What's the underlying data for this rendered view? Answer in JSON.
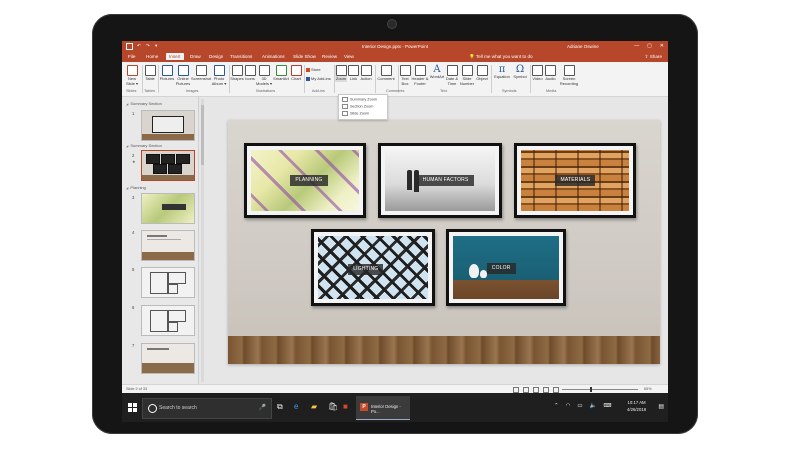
{
  "titlebar": {
    "doc_title": "Interior Design.pptx - PowerPoint",
    "user": "Adriane Oswine",
    "min": "—",
    "restore": "▢",
    "close": "✕"
  },
  "tabs": {
    "file": "File",
    "home": "Home",
    "insert": "Insert",
    "draw": "Draw",
    "design": "Design",
    "transitions": "Transitions",
    "animations": "Animations",
    "slideshow": "Slide Show",
    "review": "Review",
    "view": "View",
    "tellme": "Tell me what you want to do",
    "share": "Share"
  },
  "ribbon": {
    "new_slide": "New Slide ▾",
    "table": "Table",
    "pictures": "Pictures",
    "online_pictures": "Online Pictures",
    "screenshot": "Screenshot",
    "photo_album": "Photo Album ▾",
    "shapes": "Shapes",
    "icons": "Icons",
    "models_3d": "3D Models ▾",
    "smartart": "SmartArt",
    "chart": "Chart",
    "store": "Store",
    "my_addins": "My Add-ins",
    "zoom": "Zoom",
    "link": "Link",
    "action": "Action",
    "comment": "Comment",
    "text_box": "Text Box",
    "header_footer": "Header & Footer",
    "wordart": "WordArt",
    "date_time": "Date & Time",
    "slide_number": "Slide Number",
    "object": "Object",
    "equation": "Equation",
    "symbol": "Symbol",
    "video": "Video",
    "audio": "Audio",
    "screen_recording": "Screen Recording",
    "equation_glyph": "π",
    "symbol_glyph": "Ω",
    "wordart_glyph": "A",
    "groups": {
      "slides": "Slides",
      "tables": "Tables",
      "images": "Images",
      "illustrations": "Illustrations",
      "addins": "Add-ins",
      "links": "Links",
      "comments": "Comments",
      "text": "Text",
      "symbols": "Symbols",
      "media": "Media"
    }
  },
  "zoom_menu": {
    "summary": "Summary Zoom",
    "section": "Section Zoom",
    "slide": "Slide Zoom"
  },
  "panel": {
    "sections": [
      "Summary Section",
      "Summary Section",
      "Planning"
    ],
    "slide_numbers": [
      "1",
      "2",
      "3",
      "4",
      "5",
      "6",
      "7"
    ]
  },
  "slide": {
    "labels": {
      "planning": "PLANNING",
      "human_factors": "HUMAN FACTORS",
      "materials": "MATERIALS",
      "lighting": "LIGHTING",
      "color": "COLOR"
    }
  },
  "statusbar": {
    "slide_info": "Slide 2 of 33",
    "zoom_pct": "65%"
  },
  "taskbar": {
    "search_placeholder": "Search to search",
    "active_app": "Interior Design - Po...",
    "time": "10:17 AM",
    "date": "4/26/2018"
  },
  "colors": {
    "accent": "#b7472a",
    "ribbon_bg": "#f3f3f3",
    "taskbar_bg": "#1f1f1f"
  }
}
